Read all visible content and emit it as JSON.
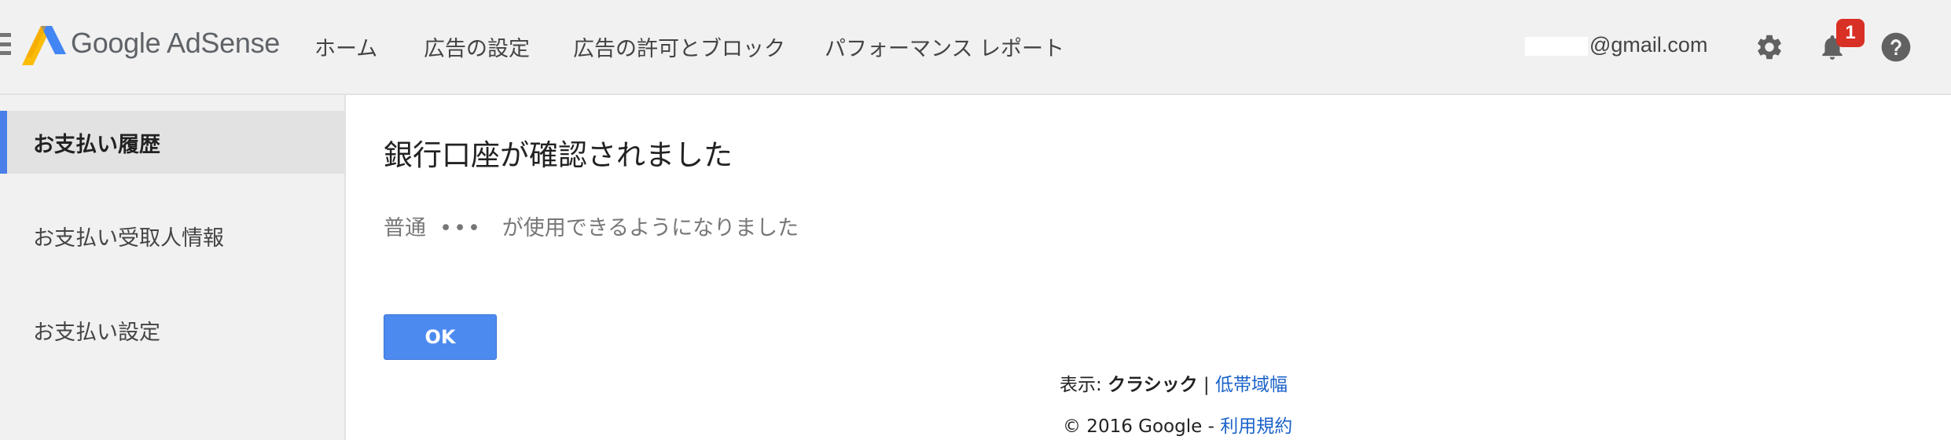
{
  "header": {
    "brand": "Google AdSense",
    "nav": [
      "ホーム",
      "広告の設定",
      "広告の許可とブロック",
      "パフォーマンス レポート"
    ],
    "email": "@gmail.com",
    "notification_count": "1",
    "icons": [
      "menu-icon",
      "adsense-logo-icon",
      "gear-icon",
      "bell-icon",
      "help-icon"
    ]
  },
  "sidebar": {
    "items": [
      {
        "label": "お支払い履歴",
        "active": true
      },
      {
        "label": "お支払い受取人情報",
        "active": false
      },
      {
        "label": "お支払い設定",
        "active": false
      }
    ]
  },
  "main": {
    "title": "銀行口座が確認されました",
    "message_prefix": "普通",
    "message_dots": "•••",
    "message_suffix": "が使用できるようになりました",
    "ok_label": "OK"
  },
  "footer": {
    "view_label": "表示:",
    "classic": "クラシック",
    "separator": "|",
    "low_bandwidth": "低帯域幅",
    "copyright": "© 2016 Google -",
    "terms": "利用規約"
  },
  "colors": {
    "accent": "#4a7ee8",
    "button": "#4d8af0",
    "badge": "#d93025",
    "link": "#1a62c9",
    "header_bg": "#f1f1f1"
  }
}
